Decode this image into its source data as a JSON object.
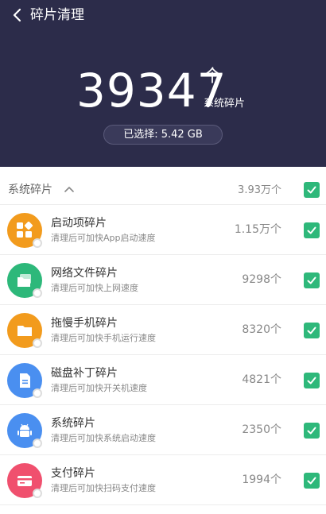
{
  "nav": {
    "title": "碎片清理"
  },
  "summary": {
    "count": "39347",
    "unit": "个",
    "caption": "系统碎片",
    "selected": "已选择: 5.42 GB"
  },
  "section": {
    "title": "系统碎片",
    "total": "3.93万个",
    "checked": true
  },
  "items": [
    {
      "title": "启动项碎片",
      "desc": "清理后可加快App启动速度",
      "count": "1.15万个",
      "icon": "apps-grid-icon",
      "color": "#f29b1d",
      "checked": true
    },
    {
      "title": "网络文件碎片",
      "desc": "清理后可加快上网速度",
      "count": "9298个",
      "icon": "network-folder-icon",
      "color": "#2db87a",
      "checked": true
    },
    {
      "title": "拖慢手机碎片",
      "desc": "清理后可加快手机运行速度",
      "count": "8320个",
      "icon": "folder-icon",
      "color": "#f29b1d",
      "checked": true
    },
    {
      "title": "磁盘补丁碎片",
      "desc": "清理后可加快开关机速度",
      "count": "4821个",
      "icon": "document-icon",
      "color": "#4a8ff0",
      "checked": true
    },
    {
      "title": "系统碎片",
      "desc": "清理后可加快系统启动速度",
      "count": "2350个",
      "icon": "android-icon",
      "color": "#4a8ff0",
      "checked": true
    },
    {
      "title": "支付碎片",
      "desc": "清理后可加快扫码支付速度",
      "count": "1994个",
      "icon": "payment-card-icon",
      "color": "#f0506e",
      "checked": true
    }
  ],
  "colors": {
    "header_bg": "#2c2c4a",
    "check_green": "#2eb87a"
  }
}
